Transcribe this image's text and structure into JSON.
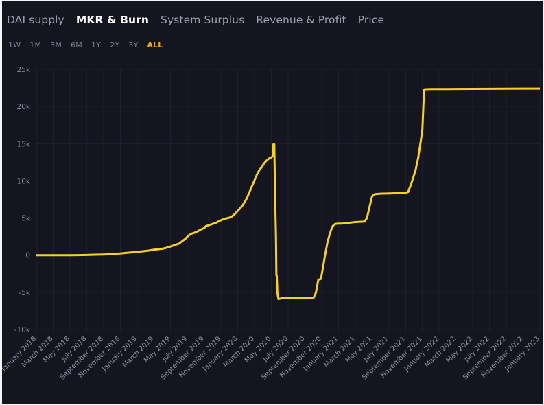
{
  "tabs": [
    {
      "label": "DAI supply",
      "active": false
    },
    {
      "label": "MKR & Burn",
      "active": true
    },
    {
      "label": "System Surplus",
      "active": false
    },
    {
      "label": "Revenue & Profit",
      "active": false
    },
    {
      "label": "Price",
      "active": false
    }
  ],
  "ranges": [
    {
      "label": "1W",
      "active": false
    },
    {
      "label": "1M",
      "active": false
    },
    {
      "label": "3M",
      "active": false
    },
    {
      "label": "6M",
      "active": false
    },
    {
      "label": "1Y",
      "active": false
    },
    {
      "label": "2Y",
      "active": false
    },
    {
      "label": "3Y",
      "active": false
    },
    {
      "label": "ALL",
      "active": true
    }
  ],
  "colors": {
    "background": "#15151f",
    "plot_background": "#15151f",
    "series": "#f5d02b",
    "accent": "#f0a81e",
    "active_tab": "#ffffff",
    "muted_text": "#8e93a3",
    "gridline": "#1d1e2e"
  },
  "chart_data": {
    "type": "line",
    "title": "",
    "xlabel": "",
    "ylabel": "",
    "ylim": [
      -10000,
      25000
    ],
    "grid": true,
    "legend": false,
    "ytick_labels": [
      "25k",
      "20k",
      "15k",
      "10k",
      "5k",
      "0",
      "-5k",
      "-10k"
    ],
    "ytick_values": [
      25000,
      20000,
      15000,
      10000,
      5000,
      0,
      -5000,
      -10000
    ],
    "xtick_labels": [
      "January 2018",
      "March 2018",
      "May 2018",
      "July 2018",
      "September 2018",
      "November 2018",
      "January 2019",
      "March 2019",
      "May 2019",
      "July 2019",
      "September 2019",
      "November 2019",
      "January 2020",
      "March 2020",
      "May 2020",
      "July 2020",
      "September 2020",
      "November 2020",
      "January 2021",
      "March 2021",
      "May 2021",
      "July 2021",
      "September 2021",
      "November 2021",
      "January 2022",
      "March 2022",
      "May 2022",
      "July 2022",
      "September 2022",
      "November 2022",
      "January 2023"
    ],
    "x_start": "January 2018",
    "x_end": "January 2023",
    "series": [
      {
        "name": "MKR & Burn",
        "color": "#f5d02b",
        "points": [
          [
            0.0,
            0
          ],
          [
            1.0,
            0
          ],
          [
            2.0,
            0
          ],
          [
            3.0,
            0
          ],
          [
            4.0,
            0
          ],
          [
            5.0,
            10
          ],
          [
            6.0,
            30
          ],
          [
            7.0,
            60
          ],
          [
            8.0,
            90
          ],
          [
            8.6,
            120
          ],
          [
            9.0,
            150
          ],
          [
            9.4,
            180
          ],
          [
            9.8,
            210
          ],
          [
            10.2,
            250
          ],
          [
            10.6,
            300
          ],
          [
            11.0,
            340
          ],
          [
            11.4,
            380
          ],
          [
            11.8,
            420
          ],
          [
            12.2,
            470
          ],
          [
            12.6,
            520
          ],
          [
            13.0,
            560
          ],
          [
            13.4,
            620
          ],
          [
            13.8,
            700
          ],
          [
            14.2,
            760
          ],
          [
            14.6,
            800
          ],
          [
            15.0,
            860
          ],
          [
            15.4,
            960
          ],
          [
            15.8,
            1100
          ],
          [
            16.2,
            1250
          ],
          [
            16.6,
            1400
          ],
          [
            17.0,
            1560
          ],
          [
            17.4,
            1900
          ],
          [
            17.8,
            2250
          ],
          [
            18.0,
            2500
          ],
          [
            18.2,
            2700
          ],
          [
            18.5,
            2900
          ],
          [
            18.8,
            3000
          ],
          [
            19.2,
            3200
          ],
          [
            19.6,
            3450
          ],
          [
            20.0,
            3650
          ],
          [
            20.2,
            3900
          ],
          [
            20.6,
            4050
          ],
          [
            21.0,
            4200
          ],
          [
            21.4,
            4350
          ],
          [
            21.8,
            4600
          ],
          [
            22.2,
            4800
          ],
          [
            22.6,
            4950
          ],
          [
            23.0,
            5050
          ],
          [
            23.3,
            5200
          ],
          [
            23.6,
            5500
          ],
          [
            23.9,
            5850
          ],
          [
            24.2,
            6200
          ],
          [
            24.5,
            6600
          ],
          [
            24.8,
            7100
          ],
          [
            25.1,
            7700
          ],
          [
            25.4,
            8500
          ],
          [
            25.7,
            9300
          ],
          [
            26.0,
            10100
          ],
          [
            26.3,
            10900
          ],
          [
            26.6,
            11500
          ],
          [
            26.9,
            11900
          ],
          [
            27.1,
            12300
          ],
          [
            27.4,
            12700
          ],
          [
            27.7,
            13000
          ],
          [
            27.9,
            13100
          ],
          [
            28.05,
            13200
          ],
          [
            28.15,
            13300
          ],
          [
            28.25,
            14900
          ],
          [
            28.35,
            14900
          ],
          [
            28.45,
            8000
          ],
          [
            28.55,
            2500
          ],
          [
            28.6,
            -2700
          ],
          [
            28.65,
            -2800
          ],
          [
            28.72,
            -5100
          ],
          [
            28.85,
            -5900
          ],
          [
            29.2,
            -5800
          ],
          [
            29.6,
            -5800
          ],
          [
            30.2,
            -5800
          ],
          [
            30.8,
            -5800
          ],
          [
            31.4,
            -5800
          ],
          [
            32.0,
            -5800
          ],
          [
            32.6,
            -5800
          ],
          [
            33.0,
            -5800
          ],
          [
            33.3,
            -5100
          ],
          [
            33.6,
            -3300
          ],
          [
            33.75,
            -3250
          ],
          [
            33.9,
            -3200
          ],
          [
            34.1,
            -2000
          ],
          [
            34.4,
            0
          ],
          [
            34.7,
            1800
          ],
          [
            35.0,
            3000
          ],
          [
            35.3,
            3900
          ],
          [
            35.6,
            4200
          ],
          [
            36.0,
            4250
          ],
          [
            36.4,
            4250
          ],
          [
            36.8,
            4280
          ],
          [
            37.2,
            4350
          ],
          [
            37.6,
            4400
          ],
          [
            38.0,
            4450
          ],
          [
            38.4,
            4480
          ],
          [
            38.8,
            4500
          ],
          [
            39.1,
            4520
          ],
          [
            39.4,
            5000
          ],
          [
            39.7,
            6500
          ],
          [
            40.0,
            7900
          ],
          [
            40.3,
            8200
          ],
          [
            40.7,
            8250
          ],
          [
            41.2,
            8280
          ],
          [
            41.8,
            8300
          ],
          [
            42.4,
            8320
          ],
          [
            43.0,
            8350
          ],
          [
            43.6,
            8380
          ],
          [
            44.0,
            8400
          ],
          [
            44.3,
            8500
          ],
          [
            44.6,
            9400
          ],
          [
            44.9,
            10400
          ],
          [
            45.2,
            11500
          ],
          [
            45.5,
            13100
          ],
          [
            45.8,
            15300
          ],
          [
            46.0,
            16900
          ],
          [
            46.2,
            22300
          ],
          [
            46.4,
            22320
          ],
          [
            47.0,
            22340
          ],
          [
            48.0,
            22350
          ],
          [
            49.0,
            22350
          ],
          [
            50.0,
            22360
          ],
          [
            52.0,
            22370
          ],
          [
            54.0,
            22380
          ],
          [
            56.0,
            22390
          ],
          [
            58.0,
            22400
          ],
          [
            60.0,
            22400
          ]
        ]
      }
    ]
  }
}
